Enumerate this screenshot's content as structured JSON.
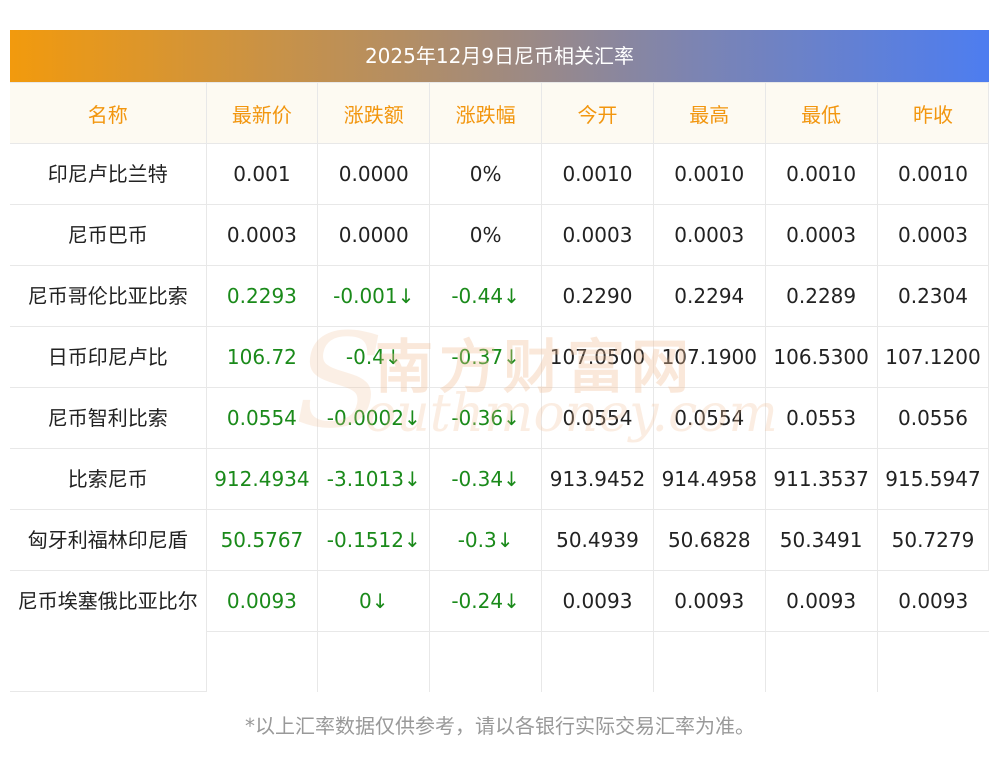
{
  "title": "2025年12月9日尼币相关汇率",
  "headers": [
    "名称",
    "最新价",
    "涨跌额",
    "涨跌幅",
    "今开",
    "最高",
    "最低",
    "昨收"
  ],
  "rows": [
    {
      "name": "印尼卢比兰特",
      "latest": "0.001",
      "change": "0.0000",
      "pct": "0%",
      "open": "0.0010",
      "high": "0.0010",
      "low": "0.0010",
      "prev": "0.0010",
      "dir": "flat"
    },
    {
      "name": "尼币巴币",
      "latest": "0.0003",
      "change": "0.0000",
      "pct": "0%",
      "open": "0.0003",
      "high": "0.0003",
      "low": "0.0003",
      "prev": "0.0003",
      "dir": "flat"
    },
    {
      "name": "尼币哥伦比亚比索",
      "latest": "0.2293",
      "change": "-0.001↓",
      "pct": "-0.44↓",
      "open": "0.2290",
      "high": "0.2294",
      "low": "0.2289",
      "prev": "0.2304",
      "dir": "down"
    },
    {
      "name": "日币印尼卢比",
      "latest": "106.72",
      "change": "-0.4↓",
      "pct": "-0.37↓",
      "open": "107.0500",
      "high": "107.1900",
      "low": "106.5300",
      "prev": "107.1200",
      "dir": "down"
    },
    {
      "name": "尼币智利比索",
      "latest": "0.0554",
      "change": "-0.0002↓",
      "pct": "-0.36↓",
      "open": "0.0554",
      "high": "0.0554",
      "low": "0.0553",
      "prev": "0.0556",
      "dir": "down"
    },
    {
      "name": "比索尼币",
      "latest": "912.4934",
      "change": "-3.1013↓",
      "pct": "-0.34↓",
      "open": "913.9452",
      "high": "914.4958",
      "low": "911.3537",
      "prev": "915.5947",
      "dir": "down"
    },
    {
      "name": "匈牙利福林印尼盾",
      "latest": "50.5767",
      "change": "-0.1512↓",
      "pct": "-0.3↓",
      "open": "50.4939",
      "high": "50.6828",
      "low": "50.3491",
      "prev": "50.7279",
      "dir": "down"
    },
    {
      "name": "尼币埃塞俄比亚比尔",
      "latest": "0.0093",
      "change": "0↓",
      "pct": "-0.24↓",
      "open": "0.0093",
      "high": "0.0093",
      "low": "0.0093",
      "prev": "0.0093",
      "dir": "down"
    }
  ],
  "watermark": {
    "cn": "南方财富网",
    "en": "outhmoney.com",
    "s": "S"
  },
  "footer": "*以上汇率数据仅供参考，请以各银行实际交易汇率为准。",
  "colors": {
    "header_text": "#f2960f",
    "down": "#1a8a1a",
    "gradient_start": "#f29a0d",
    "gradient_end": "#4d7df0"
  }
}
